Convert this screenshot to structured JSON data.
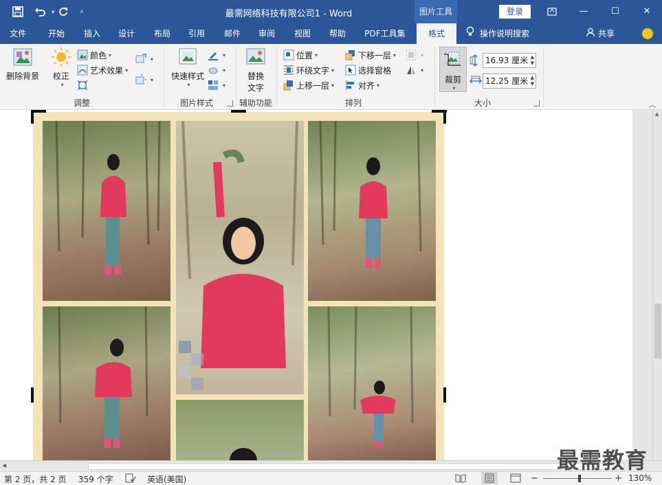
{
  "app": {
    "title": "最需网络科技有限公司1  -  Word",
    "context_tool": "图片工具",
    "login": "登录"
  },
  "tabs": [
    {
      "label": "文件"
    },
    {
      "label": "开始"
    },
    {
      "label": "插入"
    },
    {
      "label": "设计"
    },
    {
      "label": "布局"
    },
    {
      "label": "引用"
    },
    {
      "label": "邮件"
    },
    {
      "label": "审阅"
    },
    {
      "label": "视图"
    },
    {
      "label": "帮助"
    },
    {
      "label": "PDF工具集"
    },
    {
      "label": "格式"
    }
  ],
  "tell_me": "操作说明搜索",
  "share": "共享",
  "ribbon": {
    "adjust": {
      "remove_bg": "删除背景",
      "correct": "校正",
      "color": "颜色",
      "artistic": "艺术效果",
      "label": "调整"
    },
    "picture_styles": {
      "quick_styles": "快速样式",
      "label": "图片样式"
    },
    "accessibility": {
      "alt_text_line1": "替换",
      "alt_text_line2": "文字",
      "label": "辅助功能"
    },
    "arrange": {
      "position": "位置",
      "wrap_text": "环绕文字",
      "bring_forward": "上移一层",
      "send_backward": "下移一层",
      "selection_pane": "选择窗格",
      "align": "对齐",
      "label": "排列"
    },
    "size": {
      "crop": "裁剪",
      "height": "16.93 厘米",
      "width": "12.25 厘米",
      "label": "大小"
    }
  },
  "status": {
    "page": "第 2 页，共 2 页",
    "words": "359 个字",
    "language": "英语(美国)",
    "zoom": "130%",
    "zoom_minus": "−",
    "zoom_plus": "+"
  },
  "watermark": "最需教育",
  "colors": {
    "brand": "#2b579a",
    "ribbon_bg": "#f3f3f3",
    "picture_border": "#f2e4b6"
  }
}
